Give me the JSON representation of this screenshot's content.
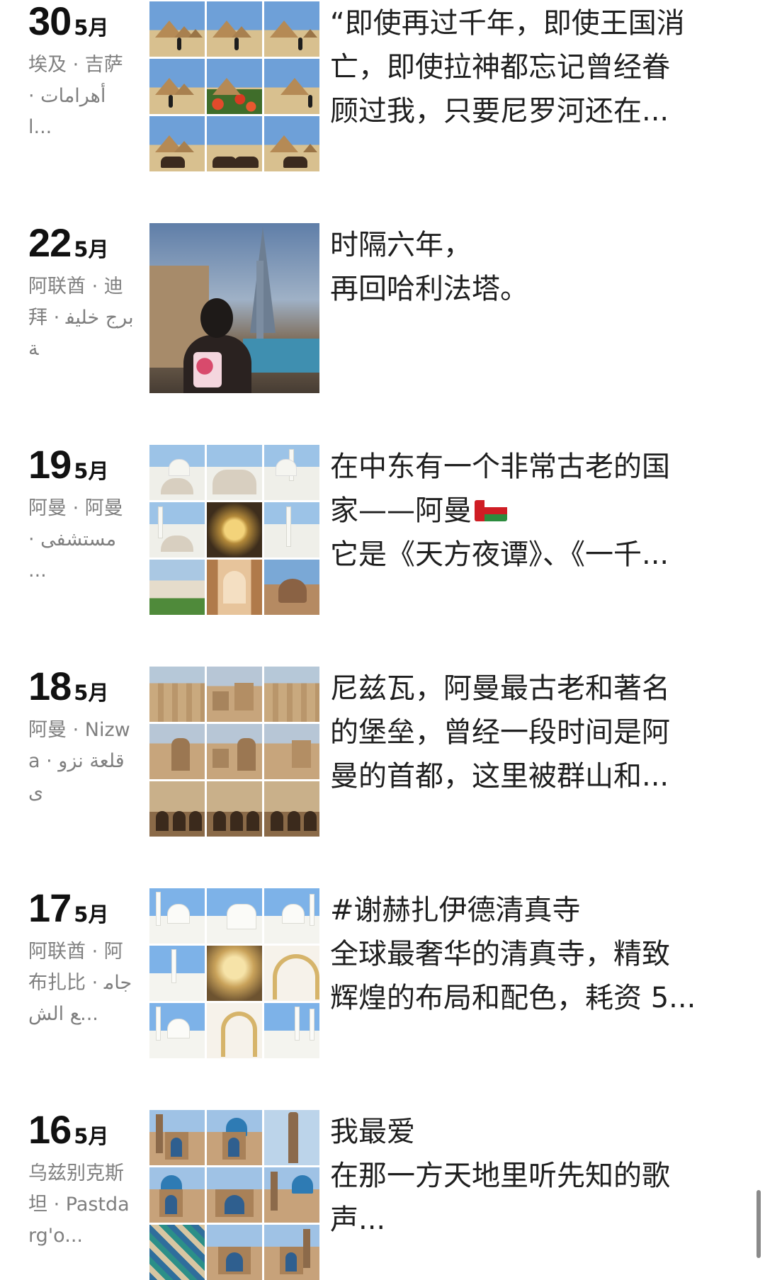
{
  "posts": [
    {
      "day": "30",
      "month": "5月",
      "location": "埃及 · 吉萨 · أهرامات ا...",
      "caption_lines": [
        "“即使再过千年，即使王国消",
        "亡，即使拉神都忘记曾经眷",
        "顾过我，只要尼罗河还在..."
      ]
    },
    {
      "day": "22",
      "month": "5月",
      "location": "阿联酋 · 迪拜 · برج خليفة",
      "caption_lines": [
        "时隔六年，",
        "再回哈利法塔。"
      ]
    },
    {
      "day": "19",
      "month": "5月",
      "location": "阿曼 · 阿曼 · مستشفى ...",
      "caption_lines": [
        "在中东有一个非常古老的国",
        "家——阿曼",
        "它是《天方夜谭》、《一千..."
      ]
    },
    {
      "day": "18",
      "month": "5月",
      "location": "阿曼 · Nizwa · قلعة نزوى",
      "caption_lines": [
        "尼兹瓦，阿曼最古老和著名",
        "的堡垒，曾经一段时间是阿",
        "曼的首都，这里被群山和..."
      ]
    },
    {
      "day": "17",
      "month": "5月",
      "location": "阿联酋 · 阿布扎比 · جامع الش...",
      "caption_lines": [
        "#谢赫扎伊德清真寺",
        "全球最奢华的清真寺，精致",
        "辉煌的布局和配色，耗资 5..."
      ]
    },
    {
      "day": "16",
      "month": "5月",
      "location": "乌兹别克斯坦 · Pastdarg'o...",
      "caption_lines": [
        "我最爱",
        "在那一方天地里听先知的歌",
        "声..."
      ]
    }
  ],
  "icons": {
    "oman_flag": "oman-flag-icon"
  },
  "colors": {
    "text": "#1f1f1f",
    "date": "#111111",
    "location": "#7f7f7f",
    "background": "#ffffff",
    "scrollbar": "#8a8a8a"
  }
}
